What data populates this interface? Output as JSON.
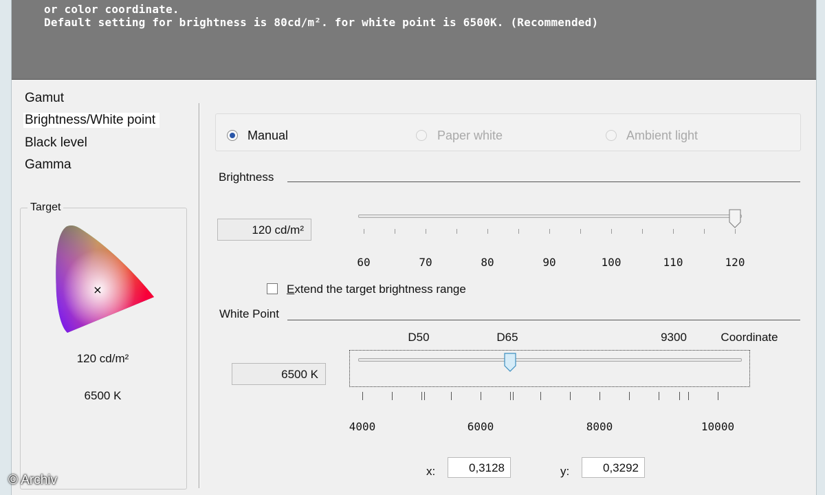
{
  "banner": {
    "line1": "or color coordinate.",
    "line2": "Default setting for brightness is 80cd/m². for white point is 6500K. (Recommended)"
  },
  "nav": {
    "items": [
      {
        "label": "Gamut"
      },
      {
        "label": "Brightness/White point"
      },
      {
        "label": "Black level"
      },
      {
        "label": "Gamma"
      }
    ],
    "selected_index": 1
  },
  "target": {
    "legend": "Target",
    "brightness": "120 cd/m²",
    "white_point": "6500 K",
    "marker": "×"
  },
  "mode": {
    "options": [
      {
        "label": "Manual",
        "selected": true,
        "enabled": true
      },
      {
        "label": "Paper white",
        "selected": false,
        "enabled": false
      },
      {
        "label": "Ambient light",
        "selected": false,
        "enabled": false
      }
    ]
  },
  "brightness": {
    "label": "Brightness",
    "value_text": "120 cd/m²",
    "min": 60,
    "max": 120,
    "value": 120,
    "scale_labels": [
      "60",
      "70",
      "80",
      "90",
      "100",
      "110",
      "120"
    ],
    "extend_label": "Extend the target brightness range",
    "extend_accesskey": "E",
    "extend_checked": false
  },
  "white_point": {
    "label": "White Point",
    "value_text": "6500 K",
    "min": 4000,
    "max": 10000,
    "value": 6500,
    "preset_labels": [
      {
        "label": "D50",
        "value": 5000
      },
      {
        "label": "D65",
        "value": 6500
      },
      {
        "label": "9300",
        "value": 9300
      },
      {
        "label": "Coordinate",
        "value": null
      }
    ],
    "scale_labels": [
      "4000",
      "6000",
      "8000",
      "10000"
    ],
    "x_label": "x:",
    "x_value": "0,3128",
    "y_label": "y:",
    "y_value": "0,3292"
  },
  "watermark": "© Archiv",
  "colors": {
    "banner_bg": "#7a7a7a",
    "window_bg": "#f0f0f0",
    "radio_dot": "#2a56a8",
    "thumb_blue": "#5fb4e0"
  }
}
